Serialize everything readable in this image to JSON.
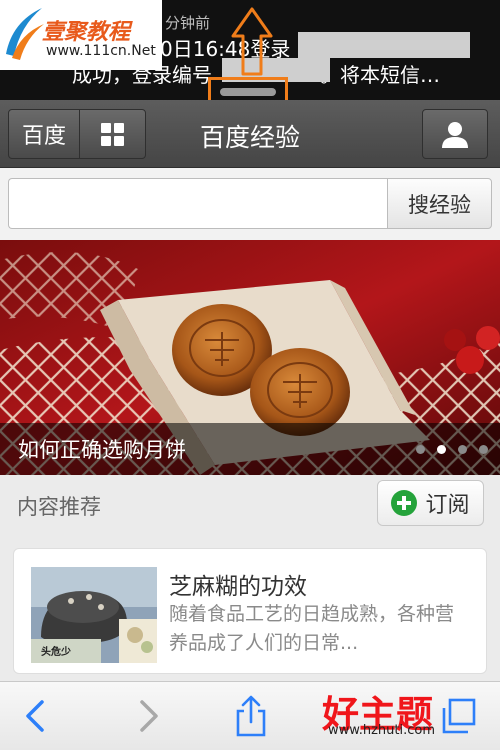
{
  "notification": {
    "time": "分钟前",
    "line1": "0日16:48登录",
    "line2_start": "成功，登录编号",
    "line2_end": "。将本短信…"
  },
  "logo": {
    "name": "壹聚教程",
    "url": "www.111cn.Net"
  },
  "header": {
    "baidu_label": "百度",
    "title": "百度经验"
  },
  "search": {
    "placeholder": "",
    "button_label": "搜经验"
  },
  "banner": {
    "caption": "如何正确选购月饼",
    "slide_count": 4,
    "active_slide": 2
  },
  "recommend": {
    "title": "内容推荐",
    "subscribe_label": "订阅"
  },
  "article": {
    "title": "芝麻糊的功效",
    "description": "随着食品工艺的日趋成熟，各种营养品成了人们的日常...",
    "thumb_caption": "头危少"
  },
  "watermark": {
    "text": "好主题",
    "url": "www.hzhuti.com"
  },
  "colors": {
    "accent_orange": "#f07d1a",
    "subscribe_green": "#25a33b",
    "watermark_red": "#f0161b",
    "header_bg": "#505050"
  }
}
